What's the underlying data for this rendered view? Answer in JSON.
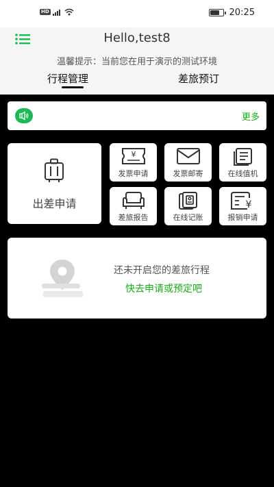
{
  "status_bar": {
    "network_badge": "HD",
    "time": "20:25",
    "battery_level": 0.8,
    "icons": [
      "hd-badge-icon",
      "signal-icon",
      "wifi-icon",
      "battery-icon"
    ]
  },
  "header": {
    "menu_icon": "list-menu-icon",
    "title": "Hello,test8",
    "tip": "温馨提示：当前您在用于演示的测试环境",
    "tabs": [
      {
        "label": "行程管理",
        "selected": true
      },
      {
        "label": "差旅预订",
        "selected": false
      }
    ]
  },
  "notice": {
    "icon": "speaker-icon",
    "more_label": "更多"
  },
  "services": {
    "main": {
      "label": "出差申请",
      "icon": "suitcase-icon"
    },
    "items": [
      {
        "label": "发票申请",
        "icon": "invoice-icon"
      },
      {
        "label": "发票邮寄",
        "icon": "mail-icon"
      },
      {
        "label": "在线值机",
        "icon": "checkin-icon"
      },
      {
        "label": "差旅报告",
        "icon": "sofa-icon"
      },
      {
        "label": "在线记账",
        "icon": "ledger-icon"
      },
      {
        "label": "报销申请",
        "icon": "reimbursement-icon"
      }
    ]
  },
  "empty_state": {
    "illustration": "map-pin-icon",
    "message": "还未开启您的差旅行程",
    "action": "快去申请或预定吧"
  },
  "colors": {
    "accent": "#1aad19",
    "background": "#000000",
    "header_bg": "#f5f5f5"
  }
}
